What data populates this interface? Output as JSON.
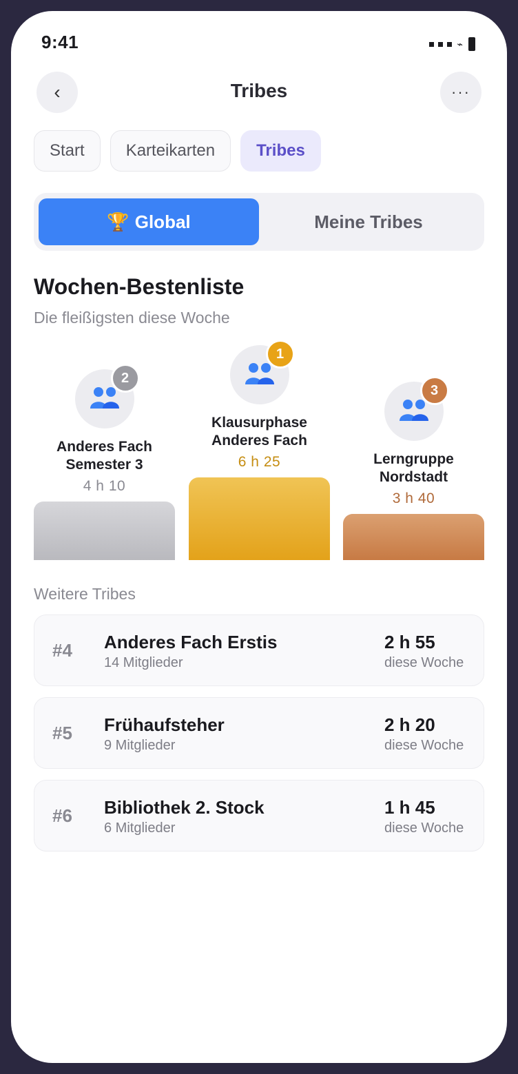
{
  "status_bar": {
    "time": "9:41"
  },
  "header": {
    "title": "Tribes",
    "back_icon": "‹",
    "more_icon": "···"
  },
  "tabs": [
    {
      "label": "Start"
    },
    {
      "label": "Karteikarten"
    },
    {
      "label": "Tribes",
      "active": true
    }
  ],
  "segment": {
    "active_label": "Global",
    "active_icon": "🏆",
    "inactive_label": "Meine Tribes"
  },
  "leaderboard": {
    "title": "Wochen-Bestenliste",
    "subtitle": "Die fleißigsten diese Woche",
    "podium": [
      {
        "rank": "2",
        "name_line1": "Anderes Fach",
        "name_line2": "Semester 3",
        "time": "4 h 10",
        "badge_color": "#9a9aa0",
        "time_color": "#8a8a92"
      },
      {
        "rank": "1",
        "name_line1": "Klausurphase",
        "name_line2": "Anderes Fach",
        "time": "6 h 25",
        "badge_color": "#e8a317",
        "time_color": "#c58d12"
      },
      {
        "rank": "3",
        "name_line1": "Lerngruppe",
        "name_line2": "Nordstadt",
        "time": "3 h 40",
        "badge_color": "#c97b44",
        "time_color": "#b06a3a"
      }
    ]
  },
  "more_tribes": {
    "label": "Weitere Tribes",
    "items": [
      {
        "rank": "#4",
        "name": "Anderes Fach Erstis",
        "members": "14 Mitglieder",
        "time": "2 h 55",
        "period": "diese Woche"
      },
      {
        "rank": "#5",
        "name": "Frühaufsteher",
        "members": "9 Mitglieder",
        "time": "2 h 20",
        "period": "diese Woche"
      },
      {
        "rank": "#6",
        "name": "Bibliothek 2. Stock",
        "members": "6 Mitglieder",
        "time": "1 h 45",
        "period": "diese Woche"
      }
    ]
  }
}
